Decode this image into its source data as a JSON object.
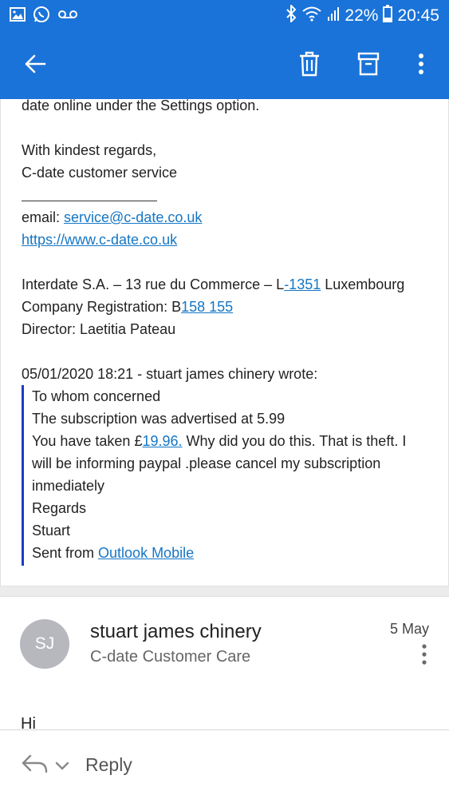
{
  "status_bar": {
    "battery_pct": "22%",
    "time": "20:45",
    "icons": [
      "image-icon",
      "whatsapp-icon",
      "voicemail-icon",
      "bluetooth-icon",
      "wifi-icon",
      "signal-icon",
      "battery-icon"
    ]
  },
  "toolbar": {
    "icons": [
      "back-arrow-icon",
      "trash-icon",
      "archive-icon",
      "more-vert-icon"
    ]
  },
  "message_body": {
    "line_settings": "date online under the Settings option.",
    "regards": "With kindest regards,",
    "signature": "C-date customer service",
    "email_prefix": "email: ",
    "email": "service@c-date.co.uk",
    "website": "https://www.c-date.co.uk",
    "address_prefix": "Interdate S.A. – 13 rue du Commerce – L",
    "address_postcode": "-1351",
    "address_suffix": " Luxembourg",
    "registration_prefix": "Company Registration: B",
    "registration_number": "158 155",
    "director": "Director: Laetitia Pateau",
    "quote_header": "05/01/2020 18:21 - stuart james chinery wrote:",
    "quote": {
      "line1": "To whom concerned",
      "line2": "The subscription was advertised at 5.99",
      "line3_prefix": "You have taken £",
      "line3_amount": "19.96.",
      "line3_suffix": " Why did you do this. That is theft. I",
      "line4": "will be informing paypal .please cancel my subscription",
      "line5": "inmediately",
      "line6": "Regards",
      "line7": "Stuart",
      "sent_prefix": "Sent from ",
      "sent_link": "Outlook Mobile"
    }
  },
  "second_message": {
    "avatar_initials": "SJ",
    "sender": "stuart james chinery",
    "recipient": "C-date Customer Care",
    "date": "5 May",
    "greeting": "Hi"
  },
  "reply_bar": {
    "label": "Reply"
  },
  "colors": {
    "app_bar": "#1a73d8",
    "link": "#1576c5",
    "quote_bar": "#1f3bc2",
    "avatar": "#b7b8be"
  }
}
